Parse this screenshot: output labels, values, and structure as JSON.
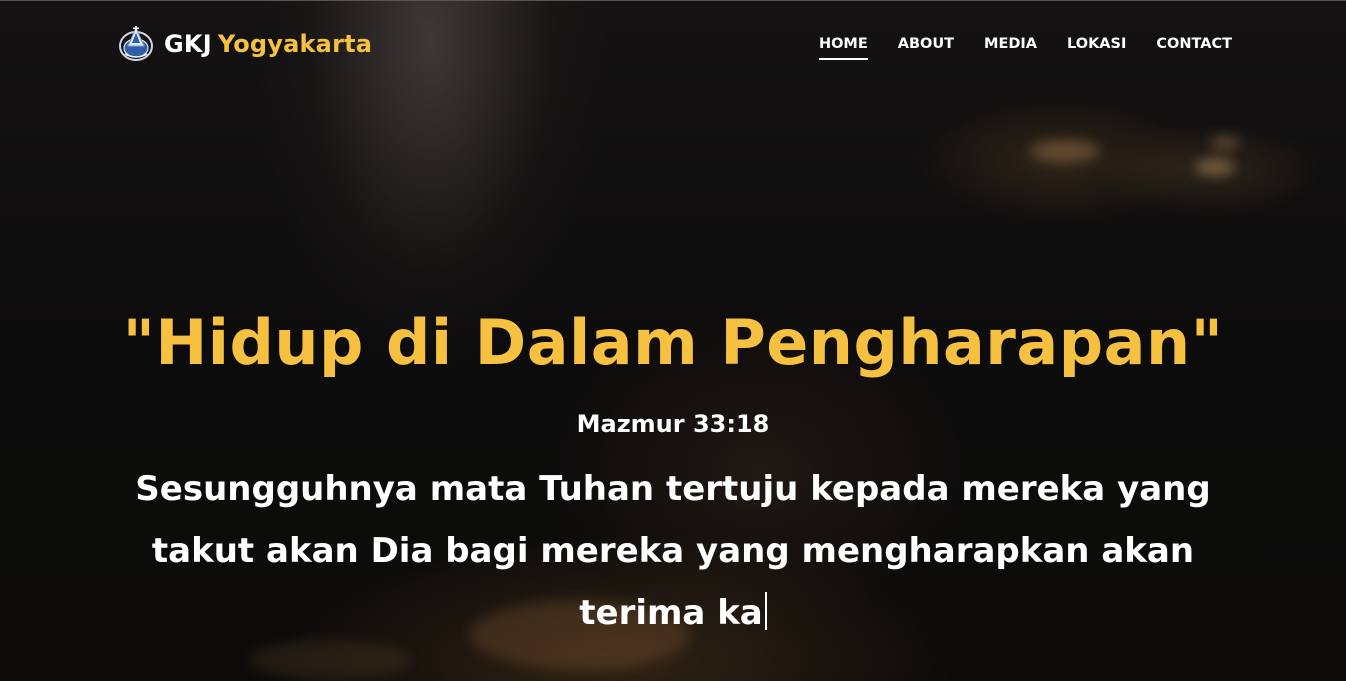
{
  "brand": {
    "name_primary": "GKJ",
    "name_accent": "Yogyakarta",
    "logo_icon": "church-emblem-icon",
    "accent_color": "#f6c141"
  },
  "nav": {
    "items": [
      {
        "label": "HOME",
        "active": true
      },
      {
        "label": "ABOUT",
        "active": false
      },
      {
        "label": "MEDIA",
        "active": false
      },
      {
        "label": "LOKASI",
        "active": false
      },
      {
        "label": "CONTACT",
        "active": false
      }
    ]
  },
  "hero": {
    "headline": "\"Hidup di Dalam Pengharapan\"",
    "reference": "Mazmur 33:18",
    "verse": "Sesungguhnya mata Tuhan tertuju kepada mereka yang takut akan Dia bagi mereka yang mengharapkan akan terima ka"
  }
}
